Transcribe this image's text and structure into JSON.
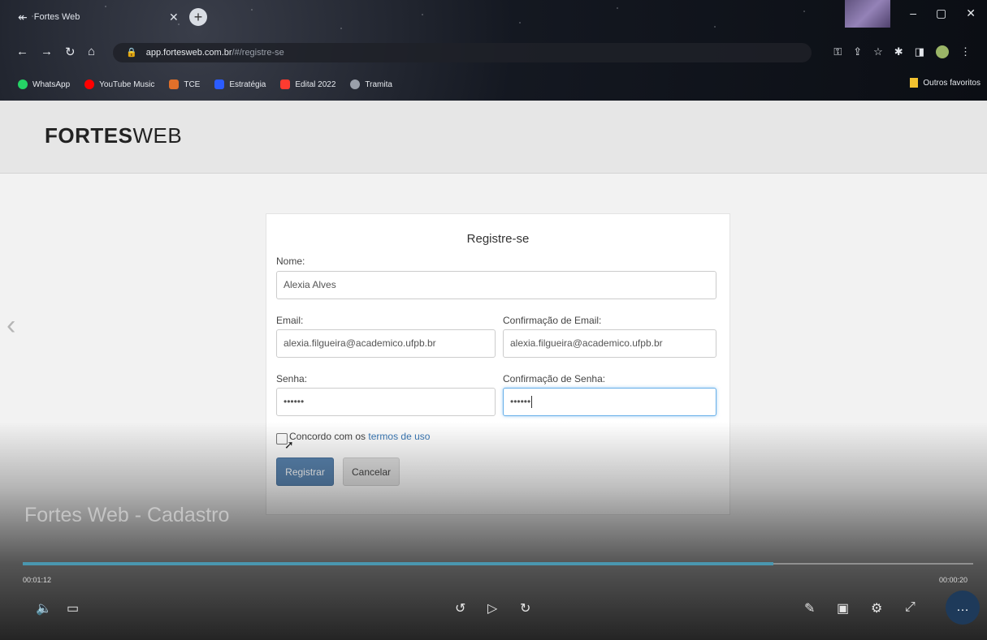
{
  "browser": {
    "tab_title": "Fortes Web",
    "url_domain": "app.fortesweb.com.br",
    "url_path": "/#/registre-se",
    "bookmarks": [
      {
        "label": "WhatsApp",
        "color": "#25d366"
      },
      {
        "label": "YouTube Music",
        "color": "#ff0000"
      },
      {
        "label": "TCE",
        "color": "#e0702a"
      },
      {
        "label": "Estratégia",
        "color": "#2b5cff"
      },
      {
        "label": "Edital 2022",
        "color": "#ff3b30"
      },
      {
        "label": "Tramita",
        "color": "#9aa0aa"
      }
    ],
    "other_bookmarks": "Outros favoritos"
  },
  "site": {
    "logo_bold": "FORTES",
    "logo_light": "WEB"
  },
  "form": {
    "title": "Registre-se",
    "name_label": "Nome:",
    "name_value": "Alexia Alves",
    "email_label": "Email:",
    "email_value": "alexia.filgueira@academico.ufpb.br",
    "email_confirm_label": "Confirmação de Email:",
    "email_confirm_value": "alexia.filgueira@academico.ufpb.br",
    "password_label": "Senha:",
    "password_value": "••••••",
    "password_confirm_label": "Confirmação de Senha:",
    "password_confirm_value": "••••••",
    "terms_prefix": "Concordo com os ",
    "terms_link": "termos de uso",
    "register_button": "Registrar",
    "cancel_button": "Cancelar"
  },
  "video": {
    "title": "Fortes Web - Cadastro",
    "elapsed": "00:01:12",
    "remaining": "00:00:20",
    "progress": 0.79
  }
}
